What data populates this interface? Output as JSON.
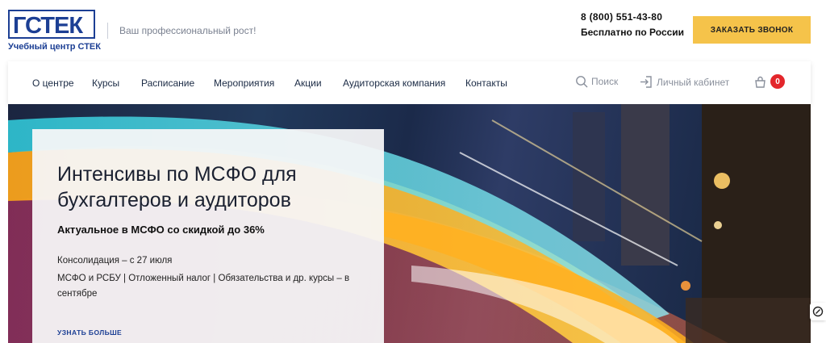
{
  "header": {
    "logo_text": "ГСТЕК",
    "logo_caption": "Учебный центр СТЕК",
    "tagline": "Ваш профессиональный рост!",
    "phone": "8 (800) 551-43-80",
    "phone_note": "Бесплатно по России",
    "call_button": "ЗАКАЗАТЬ ЗВОНОК"
  },
  "nav": {
    "items": [
      "О центре",
      "Курсы",
      "Расписание",
      "Мероприятия",
      "Акции",
      "Аудиторская компания",
      "Контакты"
    ],
    "search_label": "Поиск",
    "account_label": "Личный кабинет",
    "cart_count": "0"
  },
  "hero": {
    "title": "Интенсивы по МСФО для бухгалтеров и аудиторов",
    "subtitle": "Актуальное в МСФО со скидкой до 36%",
    "line1": "Консолидация – с 27 июля",
    "line2": "МСФО и РСБУ | Отложенный налог | Обязательства и др. курсы – в сентябре",
    "more_link": "УЗНАТЬ БОЛЬШЕ"
  },
  "colors": {
    "brand_blue": "#1c3f94",
    "accent_yellow": "#f5c34a",
    "badge_red": "#e3262b"
  },
  "icons": [
    "search-icon",
    "login-icon",
    "cart-icon",
    "chat-icon"
  ]
}
